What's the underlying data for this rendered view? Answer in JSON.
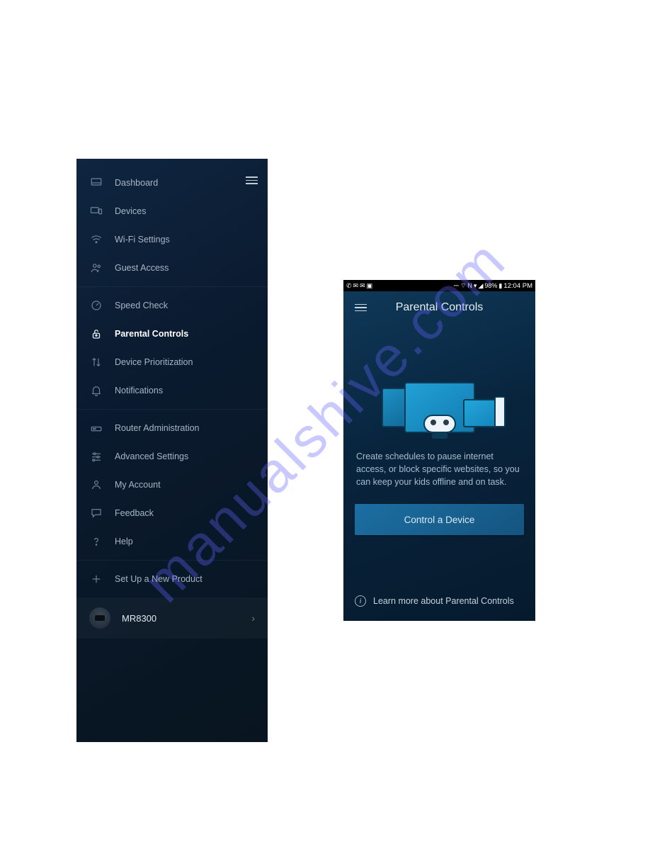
{
  "watermark": "manualshive.com",
  "sidebar": {
    "items": [
      {
        "label": "Dashboard",
        "icon": "dashboard"
      },
      {
        "label": "Devices",
        "icon": "devices"
      },
      {
        "label": "Wi-Fi Settings",
        "icon": "wifi"
      },
      {
        "label": "Guest Access",
        "icon": "guest"
      },
      {
        "label": "Speed Check",
        "icon": "speed"
      },
      {
        "label": "Parental Controls",
        "icon": "lock",
        "active": true
      },
      {
        "label": "Device Prioritization",
        "icon": "priority"
      },
      {
        "label": "Notifications",
        "icon": "bell"
      },
      {
        "label": "Router Administration",
        "icon": "router"
      },
      {
        "label": "Advanced Settings",
        "icon": "sliders"
      },
      {
        "label": "My Account",
        "icon": "account"
      },
      {
        "label": "Feedback",
        "icon": "feedback"
      },
      {
        "label": "Help",
        "icon": "help"
      },
      {
        "label": "Set Up a New Product",
        "icon": "plus"
      }
    ],
    "device_name": "MR8300"
  },
  "status_bar": {
    "battery_text": "98%",
    "time": "12:04 PM"
  },
  "parental": {
    "title": "Parental Controls",
    "description": "Create schedules to pause internet access, or block specific websites, so you can keep your kids offline and on task.",
    "button_label": "Control a Device",
    "learn_more": "Learn more about Parental Controls"
  }
}
